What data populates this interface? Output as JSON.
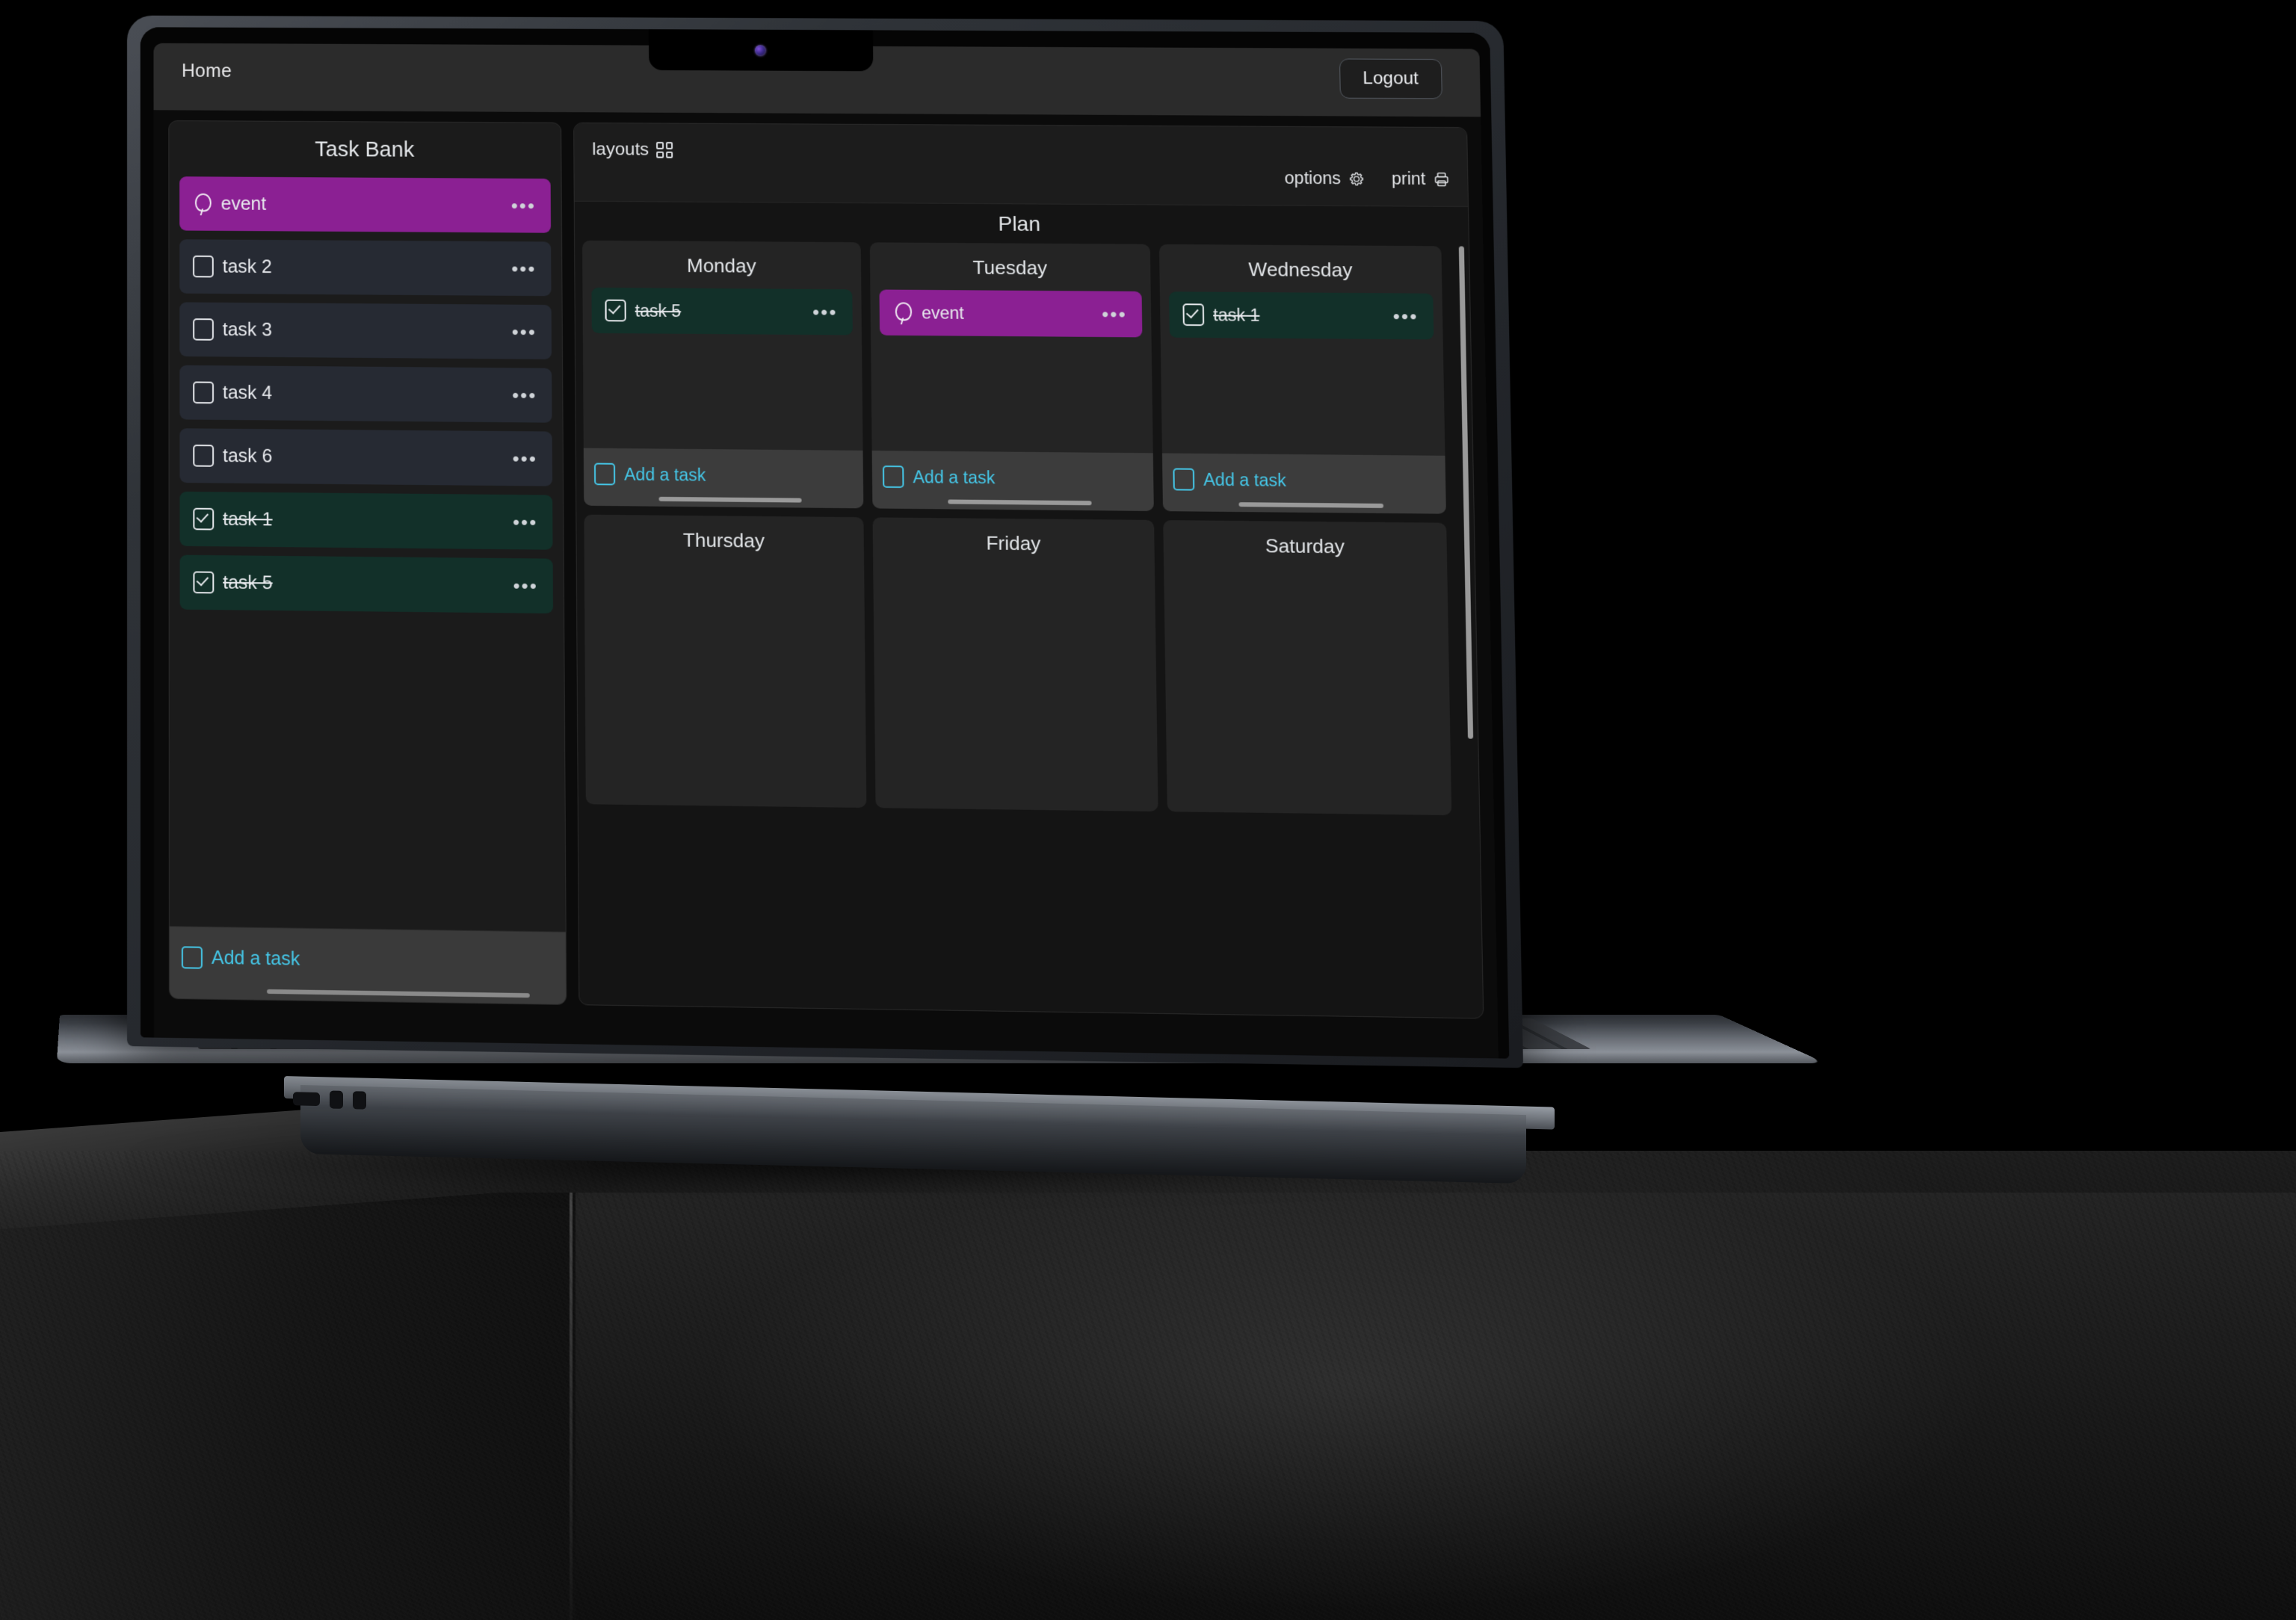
{
  "app": {
    "nav": {
      "home_label": "Home",
      "logout_label": "Logout"
    }
  },
  "sidebar": {
    "title": "Task Bank",
    "add_task_label": "Add a task",
    "items": [
      {
        "label": "event",
        "type": "event",
        "done": false,
        "color": "purple",
        "menu": "•••"
      },
      {
        "label": "task 2",
        "type": "task",
        "done": false,
        "color": "default",
        "menu": "•••"
      },
      {
        "label": "task 3",
        "type": "task",
        "done": false,
        "color": "default",
        "menu": "•••"
      },
      {
        "label": "task 4",
        "type": "task",
        "done": false,
        "color": "default",
        "menu": "•••"
      },
      {
        "label": "task 6",
        "type": "task",
        "done": false,
        "color": "default",
        "menu": "•••"
      },
      {
        "label": "task 1",
        "type": "task",
        "done": true,
        "color": "green",
        "menu": "•••"
      },
      {
        "label": "task 5",
        "type": "task",
        "done": true,
        "color": "green",
        "menu": "•••"
      }
    ]
  },
  "plan": {
    "toolbar": {
      "layouts_label": "layouts",
      "layouts_icon": "grid-icon",
      "options_label": "options",
      "options_icon": "gear-icon",
      "print_label": "print",
      "print_icon": "printer-icon"
    },
    "title": "Plan",
    "add_task_label": "Add a task",
    "days": [
      {
        "name": "Monday",
        "tasks": [
          {
            "label": "task 5",
            "type": "task",
            "done": true,
            "color": "green",
            "menu": "•••"
          }
        ]
      },
      {
        "name": "Tuesday",
        "tasks": [
          {
            "label": "event",
            "type": "event",
            "done": false,
            "color": "purple",
            "menu": "•••"
          }
        ]
      },
      {
        "name": "Wednesday",
        "tasks": [
          {
            "label": "task 1",
            "type": "task",
            "done": true,
            "color": "green",
            "menu": "•••"
          }
        ]
      },
      {
        "name": "Thursday",
        "tasks": []
      },
      {
        "name": "Friday",
        "tasks": []
      },
      {
        "name": "Saturday",
        "tasks": []
      }
    ]
  },
  "colors": {
    "accent_cyan": "#45c7e8",
    "event_purple": "#8b2093",
    "done_green": "#123029",
    "task_slate": "#262a33",
    "panel_bg": "#1b1b1b"
  }
}
